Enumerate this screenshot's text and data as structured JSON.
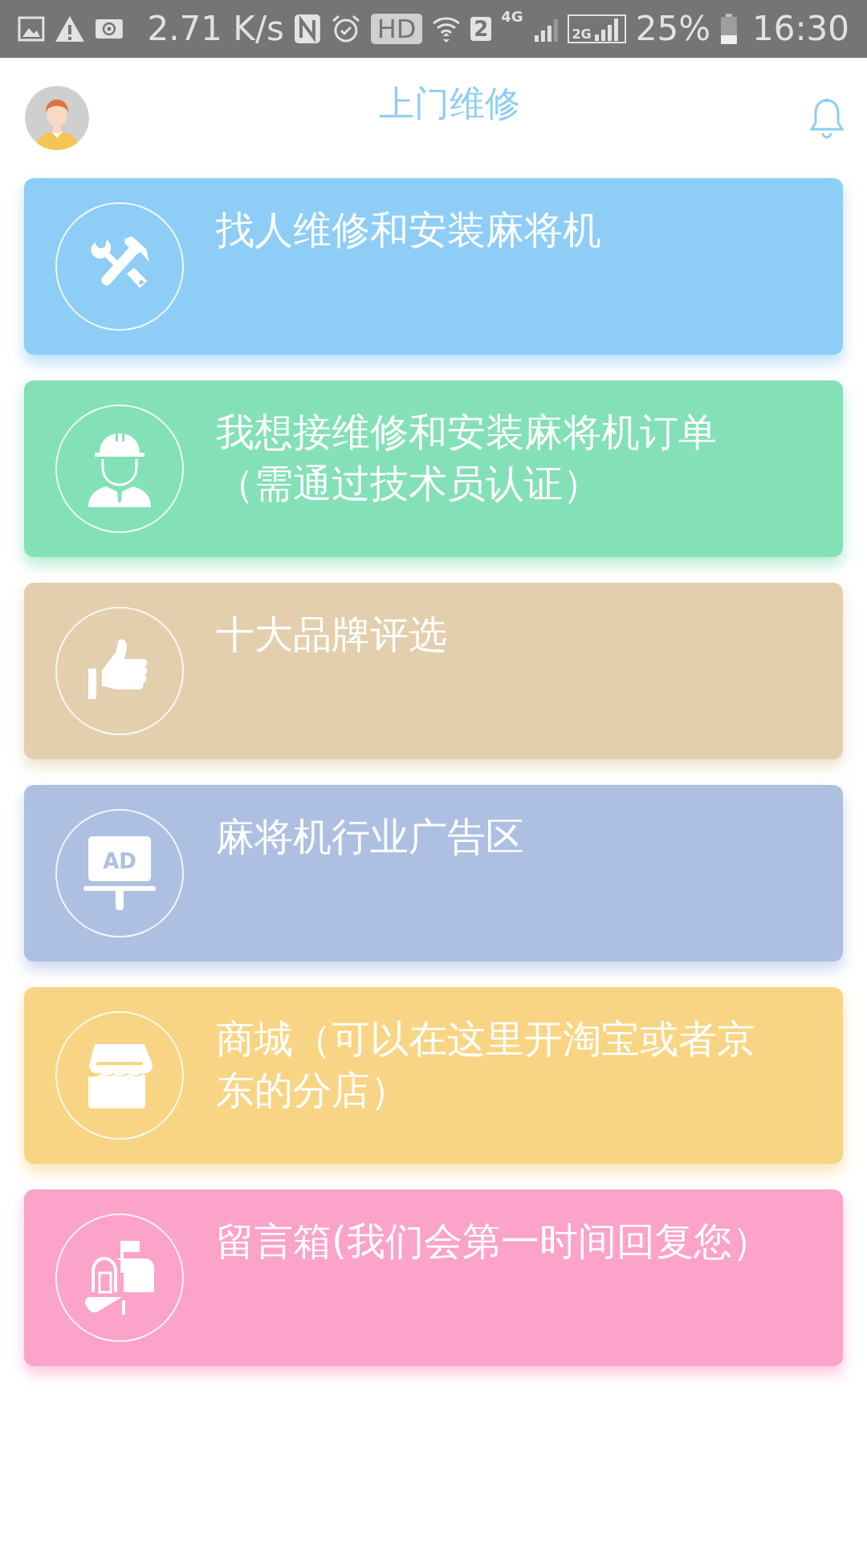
{
  "status_bar": {
    "speed": "2.71 K/s",
    "hd": "HD",
    "sim": "2",
    "network_1": "4G",
    "network_2": "2G",
    "battery": "25%",
    "time": "16:30"
  },
  "header": {
    "title": "上门维修"
  },
  "cards": [
    {
      "kind": "tools",
      "text": "找人维修和安装麻将机",
      "color": "#8ecdf6"
    },
    {
      "kind": "worker",
      "text": "我想接维修和安装麻将机订单（需通过技术员认证）",
      "color": "#84e0b7"
    },
    {
      "kind": "thumb",
      "text": "十大品牌评选",
      "color": "#e3cfae"
    },
    {
      "kind": "ad",
      "text": "麻将机行业广告区",
      "color": "#adc0e2",
      "icon_text": "AD"
    },
    {
      "kind": "shop",
      "text": "商城（可以在这里开淘宝或者京东的分店）",
      "color": "#f8d584"
    },
    {
      "kind": "mailbox",
      "text": "留言箱(我们会第一时间回复您）",
      "color": "#fba3c9"
    }
  ]
}
